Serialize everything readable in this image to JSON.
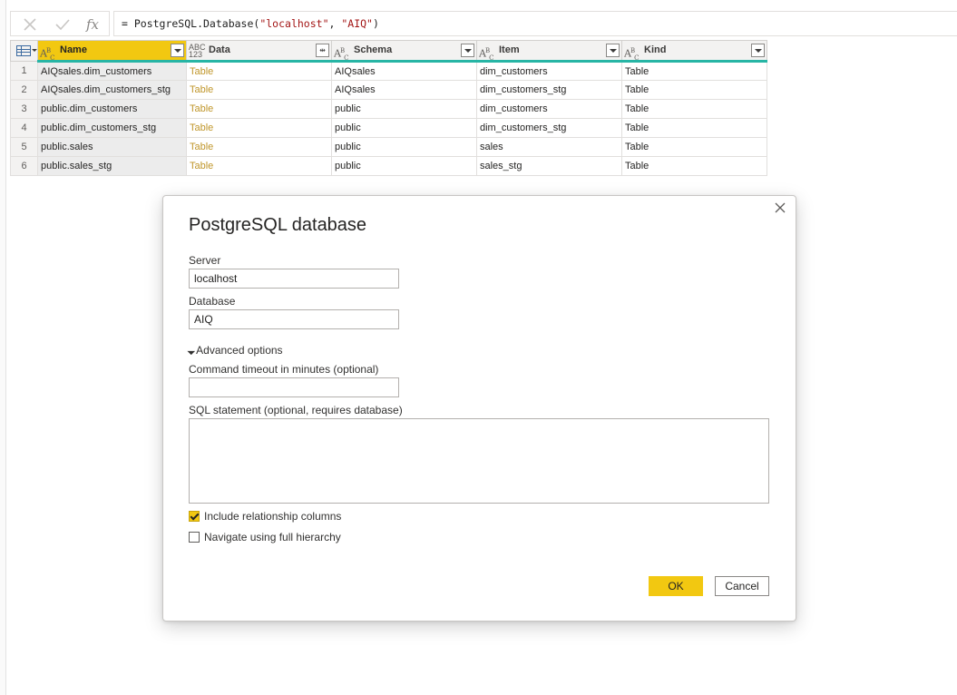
{
  "formula_bar": {
    "cancel_icon": "x-icon",
    "commit_icon": "check-icon",
    "fx_label": "fx",
    "prefix": "= PostgreSQL.Database(",
    "arg1": "\"localhost\"",
    "sep": ", ",
    "arg2": "\"AIQ\"",
    "suffix": ")"
  },
  "grid": {
    "columns": [
      {
        "label": "Name",
        "type": "ABC"
      },
      {
        "label": "Data",
        "type": "ABC123"
      },
      {
        "label": "Schema",
        "type": "ABC"
      },
      {
        "label": "Item",
        "type": "ABC"
      },
      {
        "label": "Kind",
        "type": "ABC"
      }
    ],
    "rows": [
      {
        "num": "1",
        "name": "AIQsales.dim_customers",
        "data": "Table",
        "schema": "AIQsales",
        "item": "dim_customers",
        "kind": "Table"
      },
      {
        "num": "2",
        "name": "AIQsales.dim_customers_stg",
        "data": "Table",
        "schema": "AIQsales",
        "item": "dim_customers_stg",
        "kind": "Table"
      },
      {
        "num": "3",
        "name": "public.dim_customers",
        "data": "Table",
        "schema": "public",
        "item": "dim_customers",
        "kind": "Table"
      },
      {
        "num": "4",
        "name": "public.dim_customers_stg",
        "data": "Table",
        "schema": "public",
        "item": "dim_customers_stg",
        "kind": "Table"
      },
      {
        "num": "5",
        "name": "public.sales",
        "data": "Table",
        "schema": "public",
        "item": "sales",
        "kind": "Table"
      },
      {
        "num": "6",
        "name": "public.sales_stg",
        "data": "Table",
        "schema": "public",
        "item": "sales_stg",
        "kind": "Table"
      }
    ]
  },
  "dialog": {
    "title": "PostgreSQL database",
    "server_label": "Server",
    "server_value": "localhost",
    "database_label": "Database",
    "database_value": "AIQ",
    "advanced_label": "Advanced options",
    "timeout_label": "Command timeout in minutes (optional)",
    "timeout_value": "",
    "sql_label": "SQL statement (optional, requires database)",
    "sql_value": "",
    "include_rel_label": "Include relationship columns",
    "include_rel_checked": true,
    "full_hierarchy_label": "Navigate using full hierarchy",
    "full_hierarchy_checked": false,
    "ok_label": "OK",
    "cancel_label": "Cancel",
    "close_icon": "close-icon"
  },
  "colors": {
    "accent": "#f2c811",
    "column_quality_bar": "#27b5a5",
    "table_link": "#c0962a",
    "string_literal": "#a31515"
  }
}
